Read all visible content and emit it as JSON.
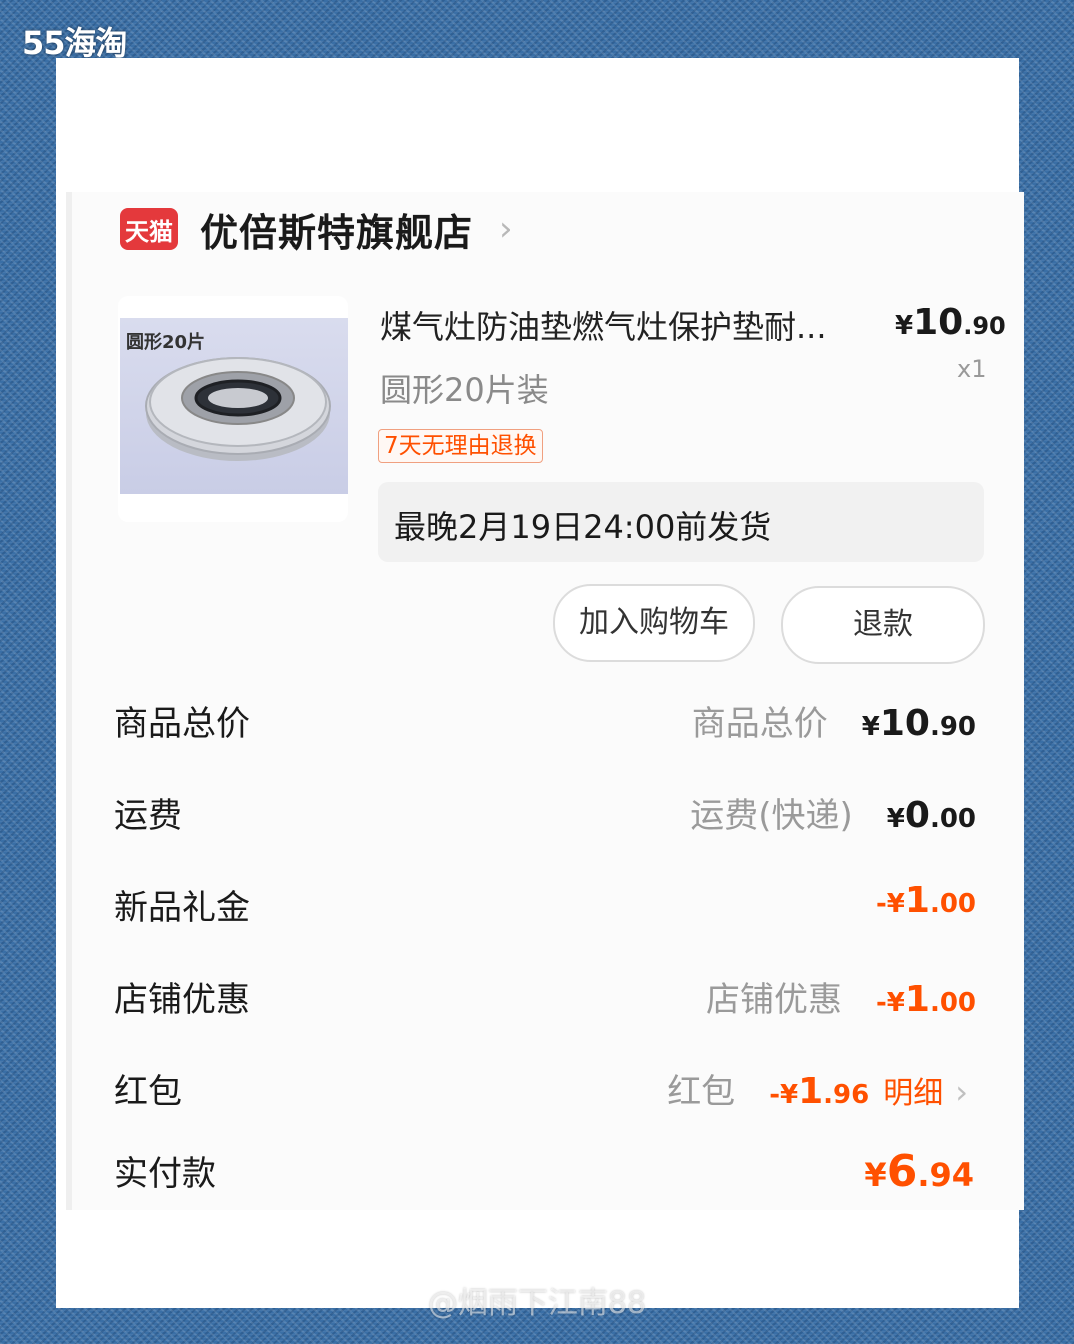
{
  "watermark": {
    "top": "55海淘",
    "bottom": "@烟雨下江南88"
  },
  "store": {
    "badge": "天猫",
    "name": "优倍斯特旗舰店",
    "chevron": "›"
  },
  "product": {
    "image_label": "圆形20片",
    "title": "煤气灶防油垫燃气灶保护垫耐...",
    "price": {
      "yen": "¥",
      "int": "10",
      "dec": ".90"
    },
    "quantity": "x1",
    "variant": "圆形20片装",
    "return_tag": "7天无理由退换",
    "shipping": "最晚2月19日24:00前发货"
  },
  "buttons": {
    "add_cart": "加入购物车",
    "refund": "退款"
  },
  "summary": {
    "goods_total": {
      "label": "商品总价",
      "sub": "商品总价",
      "yen": "¥",
      "int": "10",
      "dec": ".90"
    },
    "shipping": {
      "label": "运费",
      "sub": "运费(快递)",
      "yen": "¥",
      "int": "0",
      "dec": ".00"
    },
    "gift": {
      "label": "新品礼金",
      "yen": "-¥",
      "int": "1",
      "dec": ".00"
    },
    "store_discount": {
      "label": "店铺优惠",
      "sub": "店铺优惠",
      "yen": "-¥",
      "int": "1",
      "dec": ".00"
    },
    "red_packet": {
      "label": "红包",
      "sub": "红包",
      "yen": "-¥",
      "int": "1",
      "dec": ".96",
      "detail": "明细",
      "chevron": "›"
    },
    "paid": {
      "label": "实付款",
      "yen": "¥",
      "int": "6",
      "dec": ".94"
    }
  },
  "colors": {
    "accent": "#ff5000",
    "tmall_red": "#e4393c",
    "background": "#3a6fa6"
  }
}
